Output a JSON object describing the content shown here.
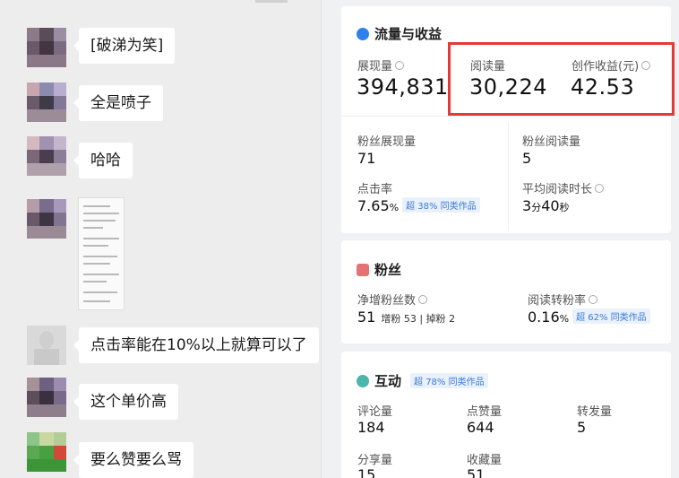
{
  "chat": {
    "messages": [
      {
        "text": "[破涕为笑]"
      },
      {
        "text": "全是喷子"
      },
      {
        "text": "哈哈"
      },
      {
        "text": "点击率能在10%以上就算可以了"
      },
      {
        "text": "这个单价高"
      },
      {
        "text": "要么赞要么骂"
      }
    ]
  },
  "traffic": {
    "title": "流量与收益",
    "impressions_label": "展现量",
    "impressions_value": "394,831",
    "reads_label": "阅读量",
    "reads_value": "30,224",
    "revenue_label": "创作收益(元)",
    "revenue_value": "42.53",
    "fan_impressions_label": "粉丝展现量",
    "fan_impressions_value": "71",
    "fan_reads_label": "粉丝阅读量",
    "fan_reads_value": "5",
    "ctr_label": "点击率",
    "ctr_value": "7.65",
    "ctr_unit": "%",
    "ctr_badge": "超 38% 同类作品",
    "avg_time_label": "平均阅读时长",
    "avg_time_min": "3",
    "avg_time_min_unit": "分",
    "avg_time_sec": "40",
    "avg_time_sec_unit": "秒"
  },
  "fans": {
    "title": "粉丝",
    "net_label": "净增粉丝数",
    "net_value": "51",
    "gain_label": "增粉",
    "gain_value": "53",
    "loss_label": "掉粉",
    "loss_value": "2",
    "conv_label": "阅读转粉率",
    "conv_value": "0.16",
    "conv_unit": "%",
    "conv_badge": "超 62% 同类作品"
  },
  "interact": {
    "title": "互动",
    "badge": "超 78% 同类作品",
    "comments_label": "评论量",
    "comments_value": "184",
    "likes_label": "点赞量",
    "likes_value": "644",
    "shares_label": "转发量",
    "shares_value": "5",
    "share_label": "分享量",
    "share_value": "15",
    "fav_label": "收藏量",
    "fav_value": "51"
  },
  "colors": {
    "accent_blue": "#3a7bd5",
    "highlight_red": "#e53935",
    "fans_icon": "#e57373",
    "interact_icon": "#4db6ac",
    "traffic_icon": "#2f80ed"
  }
}
